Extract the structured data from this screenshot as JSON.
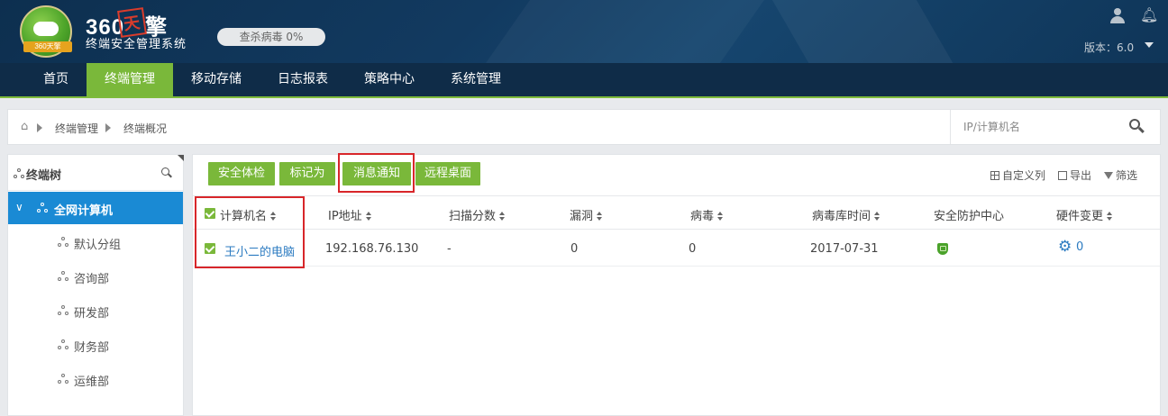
{
  "header": {
    "logo_ribbon": "360天擎",
    "brand_prefix": "360",
    "brand_stamp": "天",
    "brand_suffix": "擎",
    "brand_subtitle": "终端安全管理系统",
    "scan_status": "查杀病毒 0%",
    "version": "版本：6.0"
  },
  "nav": {
    "items": [
      "首页",
      "终端管理",
      "移动存储",
      "日志报表",
      "策略中心",
      "系统管理"
    ],
    "active": "终端管理"
  },
  "breadcrumb": {
    "items": [
      "终端管理",
      "终端概况"
    ]
  },
  "search": {
    "placeholder": "IP/计算机名"
  },
  "sidebar": {
    "title": "终端树",
    "root": "全网计算机",
    "groups": [
      "默认分组",
      "咨询部",
      "研发部",
      "财务部",
      "运维部"
    ]
  },
  "toolbar": {
    "buttons": [
      "安全体检",
      "标记为",
      "消息通知",
      "远程桌面"
    ],
    "custom_columns": "自定义列",
    "export": "导出",
    "filter": "筛选"
  },
  "table": {
    "columns": [
      "计算机名",
      "IP地址",
      "扫描分数",
      "漏洞",
      "病毒",
      "病毒库时间",
      "安全防护中心",
      "硬件变更"
    ],
    "rows": [
      {
        "name": "王小二的电脑",
        "ip": "192.168.76.130",
        "score": "-",
        "vulns": "0",
        "viruses": "0",
        "db_time": "2017-07-31",
        "protection": "shield-icon",
        "hardware_changes": "0"
      }
    ]
  },
  "colors": {
    "accent_green": "#7ab83a",
    "nav_bg": "#0f2c48",
    "sidebar_active": "#1a8ad4",
    "link_blue": "#2c7bc1",
    "highlight_red": "#d8262a"
  }
}
